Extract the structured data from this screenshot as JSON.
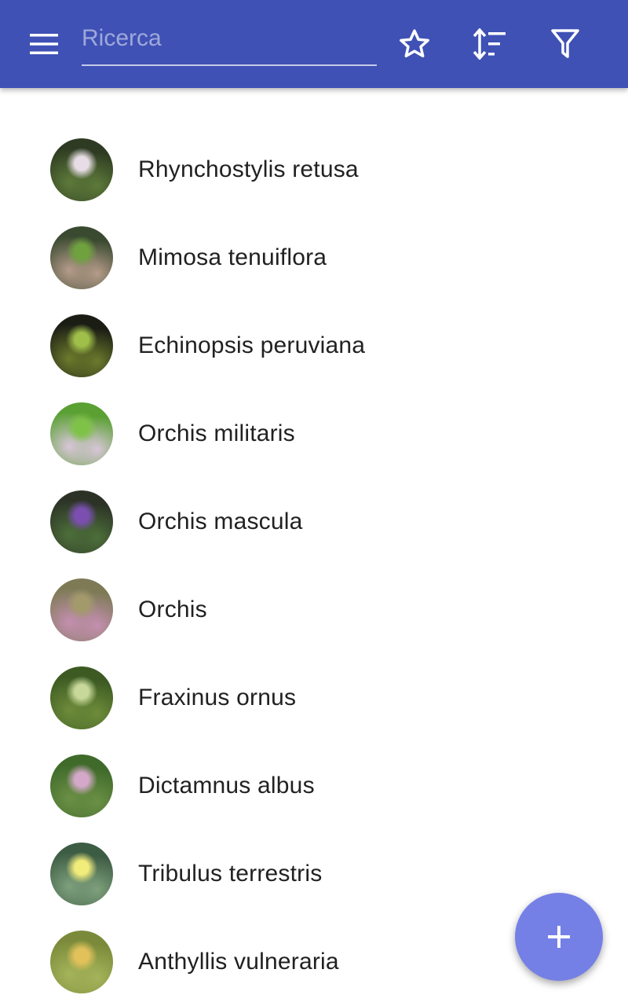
{
  "theme": {
    "appbar_color": "#3f51b5",
    "fab_color": "#7580e6",
    "text_color": "#212121"
  },
  "header": {
    "menu_icon": "menu-icon",
    "search_placeholder": "Ricerca",
    "search_value": "",
    "favorites_icon": "star-outline-icon",
    "sort_icon": "sort-icon",
    "filter_icon": "filter-icon"
  },
  "plants": [
    {
      "name": "Rhynchostylis retusa",
      "thumb_colors": [
        "#2e3b22",
        "#e8dde6",
        "#5d7a3a"
      ]
    },
    {
      "name": "Mimosa tenuiflora",
      "thumb_colors": [
        "#3a4a30",
        "#6fa23f",
        "#b59b8a"
      ]
    },
    {
      "name": "Echinopsis peruviana",
      "thumb_colors": [
        "#1b1d14",
        "#9fbf4a",
        "#6c7a2c"
      ]
    },
    {
      "name": "Orchis militaris",
      "thumb_colors": [
        "#5aa033",
        "#7fc248",
        "#d8c6d8"
      ]
    },
    {
      "name": "Orchis mascula",
      "thumb_colors": [
        "#2c3326",
        "#7a4fb0",
        "#4d6f3a"
      ]
    },
    {
      "name": "Orchis",
      "thumb_colors": [
        "#7d7a55",
        "#a39a6c",
        "#c48fb0"
      ]
    },
    {
      "name": "Fraxinus ornus",
      "thumb_colors": [
        "#3c5a22",
        "#c7d89a",
        "#6e8c3a"
      ]
    },
    {
      "name": "Dictamnus albus",
      "thumb_colors": [
        "#3f6a2a",
        "#d3a8c8",
        "#6b8f45"
      ]
    },
    {
      "name": "Tribulus terrestris",
      "thumb_colors": [
        "#3d5c44",
        "#f2ec7a",
        "#7ea07c"
      ]
    },
    {
      "name": "Anthyllis vulneraria",
      "thumb_colors": [
        "#7a8a3a",
        "#e2c15a",
        "#a5b45a"
      ]
    }
  ],
  "fab": {
    "icon": "plus-icon"
  }
}
